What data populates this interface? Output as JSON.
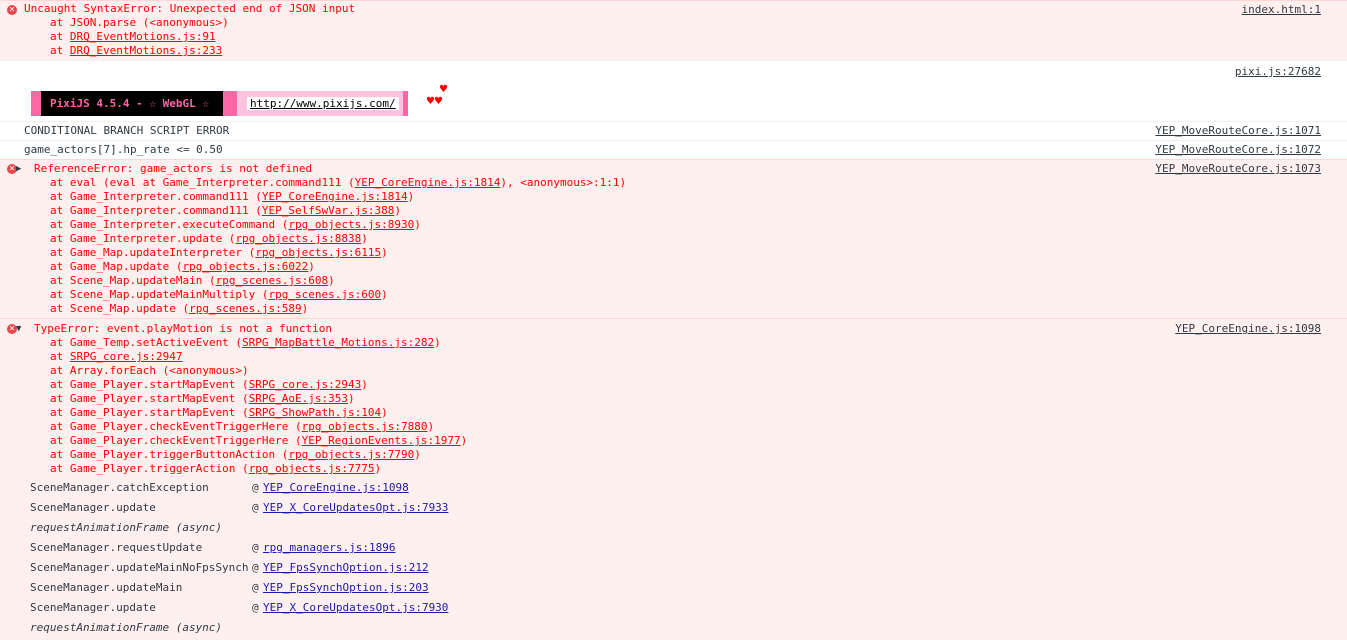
{
  "syntax_error": {
    "message": "Uncaught SyntaxError: Unexpected end of JSON input",
    "source": "index.html:1",
    "frames": [
      {
        "text": "at JSON.parse (<anonymous>)"
      },
      {
        "prefix": "at ",
        "link": "DRQ_EventMotions.js:91"
      },
      {
        "prefix": "at ",
        "link": "DRQ_EventMotions.js:233"
      }
    ]
  },
  "pixi": {
    "source": "pixi.js:27682",
    "banner_text": "PixiJS 4.5.4 - ☆ WebGL ☆",
    "url": "http://www.pixijs.com/",
    "heart": "♥",
    "hearts": "♥♥"
  },
  "logs": [
    {
      "text": "CONDITIONAL BRANCH SCRIPT ERROR",
      "source": "YEP_MoveRouteCore.js:1071"
    },
    {
      "text": "game_actors[7].hp_rate <= 0.50",
      "source": "YEP_MoveRouteCore.js:1072"
    }
  ],
  "reference_error": {
    "triangle": "▶",
    "message": "ReferenceError: game_actors is not defined",
    "source": "YEP_MoveRouteCore.js:1073",
    "frames": [
      {
        "prefix": "at eval (eval at Game_Interpreter.command111 (",
        "link": "YEP_CoreEngine.js:1814",
        "suffix": "), <anonymous>:1:1)"
      },
      {
        "prefix": "at Game_Interpreter.command111 (",
        "link": "YEP_CoreEngine.js:1814",
        "suffix": ")"
      },
      {
        "prefix": "at Game_Interpreter.command111 (",
        "link": "YEP_SelfSwVar.js:388",
        "suffix": ")"
      },
      {
        "prefix": "at Game_Interpreter.executeCommand (",
        "link": "rpg_objects.js:8930",
        "suffix": ")"
      },
      {
        "prefix": "at Game_Interpreter.update (",
        "link": "rpg_objects.js:8838",
        "suffix": ")"
      },
      {
        "prefix": "at Game_Map.updateInterpreter (",
        "link": "rpg_objects.js:6115",
        "suffix": ")"
      },
      {
        "prefix": "at Game_Map.update (",
        "link": "rpg_objects.js:6022",
        "suffix": ")"
      },
      {
        "prefix": "at Scene_Map.updateMain (",
        "link": "rpg_scenes.js:608",
        "suffix": ")"
      },
      {
        "prefix": "at Scene_Map.updateMainMultiply (",
        "link": "rpg_scenes.js:600",
        "suffix": ")"
      },
      {
        "prefix": "at Scene_Map.update (",
        "link": "rpg_scenes.js:589",
        "suffix": ")"
      }
    ]
  },
  "type_error": {
    "triangle": "▼",
    "message": "TypeError: event.playMotion is not a function",
    "source": "YEP_CoreEngine.js:1098",
    "frames": [
      {
        "prefix": "at Game_Temp.setActiveEvent (",
        "link": "SRPG_MapBattle_Motions.js:282",
        "suffix": ")"
      },
      {
        "prefix": "at ",
        "link": "SRPG_core.js:2947",
        "suffix": ""
      },
      {
        "prefix": "at Array.forEach (<anonymous>)",
        "link": "",
        "suffix": ""
      },
      {
        "prefix": "at Game_Player.startMapEvent (",
        "link": "SRPG_core.js:2943",
        "suffix": ")"
      },
      {
        "prefix": "at Game_Player.startMapEvent (",
        "link": "SRPG_AoE.js:353",
        "suffix": ")"
      },
      {
        "prefix": "at Game_Player.startMapEvent (",
        "link": "SRPG_ShowPath.js:104",
        "suffix": ")"
      },
      {
        "prefix": "at Game_Player.checkEventTriggerHere (",
        "link": "rpg_objects.js:7880",
        "suffix": ")"
      },
      {
        "prefix": "at Game_Player.checkEventTriggerHere (",
        "link": "YEP_RegionEvents.js:1977",
        "suffix": ")"
      },
      {
        "prefix": "at Game_Player.triggerButtonAction (",
        "link": "rpg_objects.js:7790",
        "suffix": ")"
      },
      {
        "prefix": "at Game_Player.triggerAction (",
        "link": "rpg_objects.js:7775",
        "suffix": ")"
      }
    ],
    "async_trace": [
      {
        "fn": "SceneManager.catchException",
        "at": "@",
        "link": "YEP_CoreEngine.js:1098"
      },
      {
        "fn": "SceneManager.update",
        "at": "@",
        "link": "YEP_X_CoreUpdatesOpt.js:7933"
      },
      {
        "async": "requestAnimationFrame (async)"
      },
      {
        "fn": "SceneManager.requestUpdate",
        "at": "@",
        "link": "rpg_managers.js:1896"
      },
      {
        "fn": "SceneManager.updateMainNoFpsSynch",
        "at": "@",
        "link": "YEP_FpsSynchOption.js:212"
      },
      {
        "fn": "SceneManager.updateMain",
        "at": "@",
        "link": "YEP_FpsSynchOption.js:203"
      },
      {
        "fn": "SceneManager.update",
        "at": "@",
        "link": "YEP_X_CoreUpdatesOpt.js:7930"
      },
      {
        "async": "requestAnimationFrame (async)"
      }
    ]
  }
}
